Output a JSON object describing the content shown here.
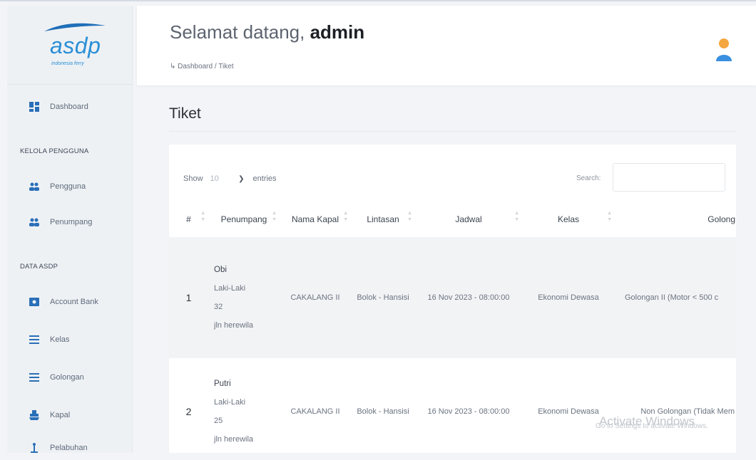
{
  "logo": {
    "brand": "asdp",
    "tagline": "indonesia ferry"
  },
  "sidebar": {
    "items": [
      {
        "label": "Dashboard",
        "icon": "dashboard-icon"
      },
      {
        "label": "Pengguna",
        "icon": "users-icon"
      },
      {
        "label": "Penumpang",
        "icon": "users-icon"
      },
      {
        "label": "Account Bank",
        "icon": "bank-card-icon"
      },
      {
        "label": "Kelas",
        "icon": "list-icon"
      },
      {
        "label": "Golongan",
        "icon": "list-icon"
      },
      {
        "label": "Kapal",
        "icon": "ship-icon"
      },
      {
        "label": "Pelabuhan",
        "icon": "anchor-icon"
      }
    ],
    "sections": [
      "KELOLA PENGGUNA",
      "DATA ASDP"
    ]
  },
  "header": {
    "greeting": "Selamat datang,",
    "username": "admin",
    "breadcrumb": "↳ Dashboard / Tiket"
  },
  "page": {
    "title": "Tiket"
  },
  "table_controls": {
    "show_label": "Show",
    "entries_value": "10",
    "entries_label": "entries",
    "search_label": "Search:"
  },
  "table": {
    "columns": [
      "#",
      "Penumpang",
      "Nama Kapal",
      "Lintasan",
      "Jadwal",
      "Kelas",
      "Golong"
    ],
    "rows": [
      {
        "no": "1",
        "penumpang": [
          "Obi",
          "Laki-Laki",
          "32",
          "jln herewila"
        ],
        "kapal": "CAKALANG II",
        "lintasan": "Bolok - Hansisi",
        "jadwal": "16 Nov 2023 - 08:00:00",
        "kelas": "Ekonomi Dewasa",
        "golongan": "Golongan II (Motor < 500 c"
      },
      {
        "no": "2",
        "penumpang": [
          "Putri",
          "Laki-Laki",
          "25",
          "jln herewila"
        ],
        "kapal": "CAKALANG II",
        "lintasan": "Bolok - Hansisi",
        "jadwal": "16 Nov 2023 - 08:00:00",
        "kelas": "Ekonomi Dewasa",
        "golongan": "Non Golongan (Tidak Mem"
      }
    ]
  },
  "watermark": {
    "line1": "Activate Windows",
    "line2": "Go to Settings to activate Windows."
  },
  "colors": {
    "brand": "#2a8fd6",
    "sidebar_bg": "#eef1f4",
    "accent_icon": "#2a6fb8"
  }
}
